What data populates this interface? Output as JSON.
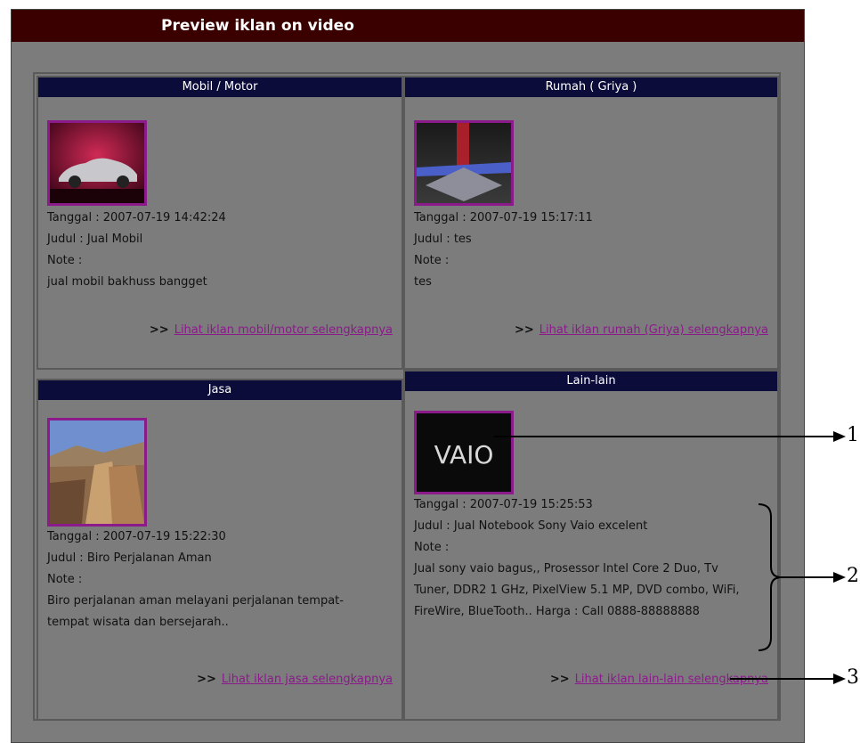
{
  "title": "Preview iklan on video",
  "cells": [
    {
      "header": "Mobil / Motor",
      "tanggal": "Tanggal : 2007-07-19 14:42:24",
      "judul": "Judul : Jual Mobil",
      "note_label": "Note :",
      "note": "jual mobil bakhuss bangget",
      "more_prefix": ">>",
      "more_link": "Lihat iklan mobil/motor selengkapnya",
      "image_icon": "car-image"
    },
    {
      "header": "Rumah ( Griya )",
      "tanggal": "Tanggal : 2007-07-19 15:17:11",
      "judul": "Judul : tes",
      "note_label": "Note :",
      "note": "tes",
      "more_prefix": ">>",
      "more_link": "Lihat iklan rumah (Griya) selengkapnya",
      "image_icon": "abstract-image"
    },
    {
      "header": "Jasa",
      "tanggal": "Tanggal : 2007-07-19 15:22:30",
      "judul": "Judul : Biro Perjalanan Aman",
      "note_label": "Note :",
      "note": "Biro perjalanan aman melayani perjalanan tempat-tempat wisata dan bersejarah..",
      "more_prefix": ">>",
      "more_link": "Lihat iklan jasa selengkapnya",
      "image_icon": "canyon-image"
    },
    {
      "header": "Lain-lain",
      "tanggal": "Tanggal : 2007-07-19 15:25:53",
      "judul": "Judul : Jual Notebook Sony Vaio excelent",
      "note_label": "Note :",
      "note": "Jual sony vaio bagus,, Prosessor Intel Core 2 Duo, Tv Tuner, DDR2 1 GHz, PixelView 5.1 MP, DVD combo, WiFi, FireWire, BlueTooth.. Harga : Call 0888-88888888",
      "more_prefix": ">>",
      "more_link": "Lihat iklan lain-lain selengkapnya",
      "image_icon": "vaio-logo-image",
      "logo_text": "VAIO"
    }
  ],
  "annotations": [
    "1",
    "2",
    "3"
  ],
  "colors": {
    "title_bg": "#3a0000",
    "header_bg": "#0c0c3a",
    "panel_bg": "#7c7c7c",
    "link": "#8b1a8b"
  }
}
